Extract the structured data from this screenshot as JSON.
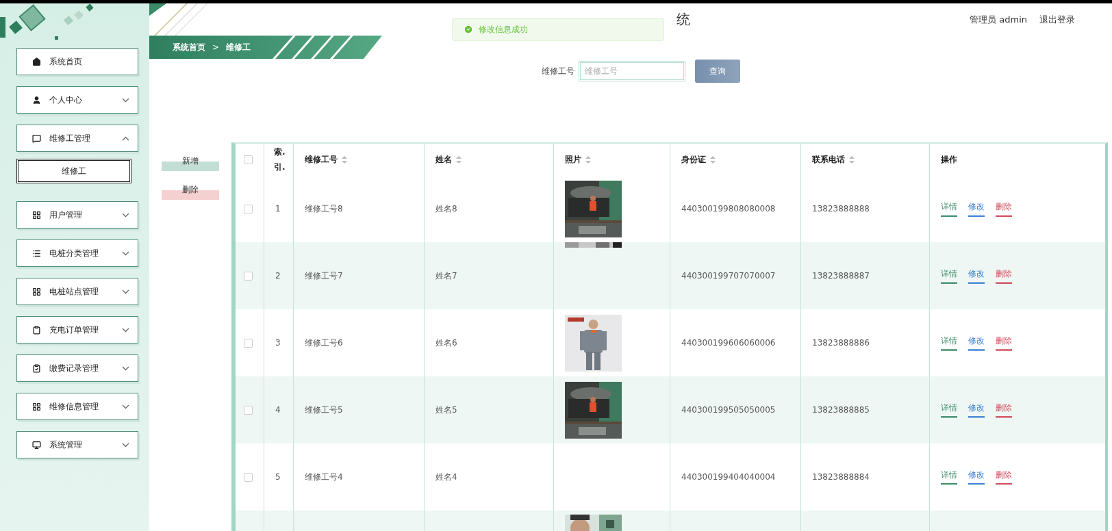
{
  "sidebar": {
    "items": [
      {
        "kind": "home",
        "label": "系统首页"
      },
      {
        "kind": "user",
        "label": "个人中心",
        "expanded": false
      },
      {
        "kind": "chat",
        "label": "维修工管理",
        "expanded": true,
        "children": [
          {
            "label": "维修工",
            "selected": true
          }
        ]
      },
      {
        "kind": "grid",
        "label": "用户管理",
        "expanded": false
      },
      {
        "kind": "list",
        "label": "电桩分类管理",
        "expanded": false
      },
      {
        "kind": "grid",
        "label": "电桩站点管理",
        "expanded": false
      },
      {
        "kind": "clipboard",
        "label": "充电订单管理",
        "expanded": false
      },
      {
        "kind": "clipboard-check",
        "label": "缴费记录管理",
        "expanded": false
      },
      {
        "kind": "grid",
        "label": "维修信息管理",
        "expanded": false
      },
      {
        "kind": "monitor",
        "label": "系统管理",
        "expanded": false
      }
    ]
  },
  "header": {
    "title": "统",
    "user": "管理员 admin",
    "logout": "退出登录"
  },
  "toast": {
    "message": "修改信息成功"
  },
  "breadcrumb": {
    "items": [
      "系统首页",
      "维修工"
    ],
    "separator": ">"
  },
  "search": {
    "label": "维修工号",
    "placeholder": "维修工号",
    "button": "查询"
  },
  "actions": {
    "add": "新增",
    "delete": "删除"
  },
  "table": {
    "header_checked": false,
    "columns": [
      {
        "label": "索.\n引.",
        "sortable": false
      },
      {
        "label": "维修工号",
        "sortable": true
      },
      {
        "label": "姓名",
        "sortable": true
      },
      {
        "label": "照片",
        "sortable": true
      },
      {
        "label": "身份证",
        "sortable": true
      },
      {
        "label": "联系电话",
        "sortable": true
      },
      {
        "label": "操作",
        "sortable": false
      }
    ],
    "rows": [
      {
        "checked": false,
        "index": "1",
        "id": "维修工号8",
        "name": "姓名8",
        "photo": {
          "kind": "picture"
        },
        "id_card": "440300199808080008",
        "phone": "13823888888",
        "ops": [
          "详情",
          "修改",
          "删除"
        ]
      },
      {
        "checked": false,
        "index": "2",
        "id": "维修工号7",
        "name": "姓名7",
        "photo": {
          "kind": "picture"
        },
        "id_card": "440300199707070007",
        "phone": "13823888887",
        "ops": [
          "详情",
          "修改",
          "删除"
        ]
      },
      {
        "checked": false,
        "index": "3",
        "id": "维修工号6",
        "name": "姓名6",
        "photo": {
          "kind": "picture"
        },
        "id_card": "440300199606060006",
        "phone": "13823888886",
        "ops": [
          "详情",
          "修改",
          "删除"
        ]
      },
      {
        "checked": false,
        "index": "4",
        "id": "维修工号5",
        "name": "姓名5",
        "photo": {
          "kind": "picture"
        },
        "id_card": "440300199505050005",
        "phone": "13823888885",
        "ops": [
          "详情",
          "修改",
          "删除"
        ]
      },
      {
        "checked": false,
        "index": "5",
        "id": "维修工号4",
        "name": "姓名4",
        "id_card": "440300199404040004",
        "phone": "13823888884",
        "ops": [
          "详情",
          "修改",
          "删除"
        ]
      },
      {
        "photo": {
          "kind": "picture"
        }
      }
    ]
  }
}
